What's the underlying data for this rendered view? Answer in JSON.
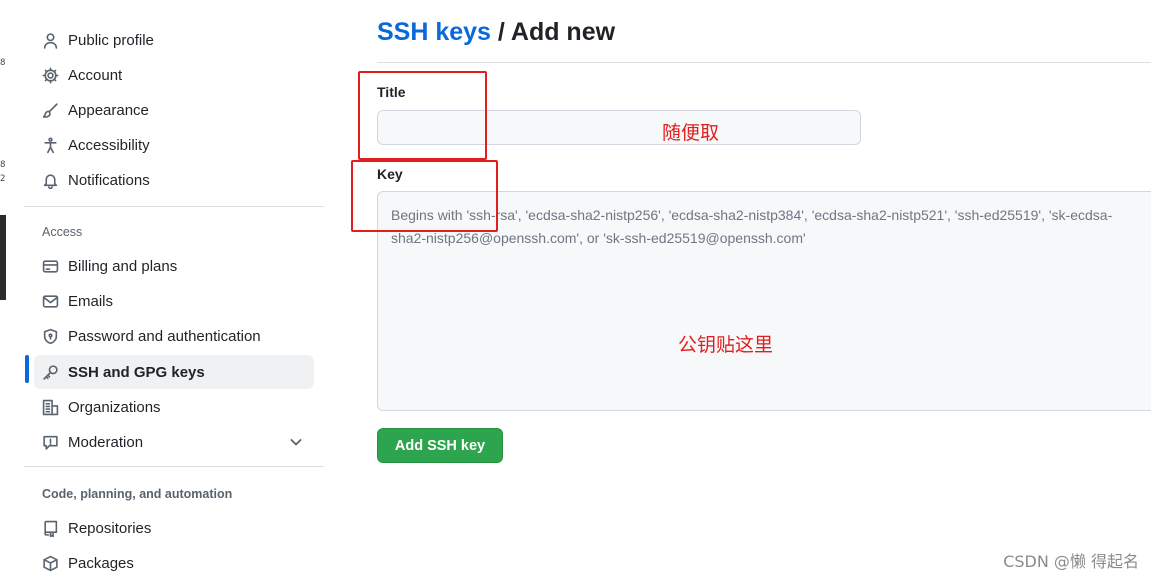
{
  "edge_chars": [
    "8",
    "8",
    "2",
    "8"
  ],
  "sidebar": {
    "top_items": [
      {
        "label": "Public profile",
        "icon": "person-icon"
      },
      {
        "label": "Account",
        "icon": "gear-icon"
      },
      {
        "label": "Appearance",
        "icon": "paintbrush-icon"
      },
      {
        "label": "Accessibility",
        "icon": "accessibility-icon"
      },
      {
        "label": "Notifications",
        "icon": "bell-icon"
      }
    ],
    "access_heading": "Access",
    "access_items": [
      {
        "label": "Billing and plans",
        "icon": "credit-card-icon"
      },
      {
        "label": "Emails",
        "icon": "mail-icon"
      },
      {
        "label": "Password and authentication",
        "icon": "shield-lock-icon"
      },
      {
        "label": "SSH and GPG keys",
        "icon": "key-icon",
        "selected": true
      },
      {
        "label": "Organizations",
        "icon": "organization-icon"
      },
      {
        "label": "Moderation",
        "icon": "report-icon"
      }
    ],
    "code_heading": "Code, planning, and automation",
    "code_items": [
      {
        "label": "Repositories",
        "icon": "repo-icon"
      },
      {
        "label": "Packages",
        "icon": "package-icon"
      }
    ]
  },
  "main": {
    "breadcrumb": "SSH keys",
    "separator": " / ",
    "title": "Add new",
    "title_label": "Title",
    "title_value": "",
    "key_label": "Key",
    "key_placeholder": "Begins with 'ssh-rsa', 'ecdsa-sha2-nistp256', 'ecdsa-sha2-nistp384', 'ecdsa-sha2-nistp521', 'ssh-ed25519', 'sk-ecdsa-\nsha2-nistp256@openssh.com', or 'sk-ssh-ed25519@openssh.com'",
    "submit_label": "Add SSH key"
  },
  "annotations": {
    "title_note": "随便取",
    "key_note": "公钥贴这里",
    "color": "#e0201f"
  },
  "watermark": "CSDN @懒 得起名",
  "colors": {
    "accent": "#0969da",
    "button": "#2da44e",
    "selected_bg": "#eff1f3"
  }
}
